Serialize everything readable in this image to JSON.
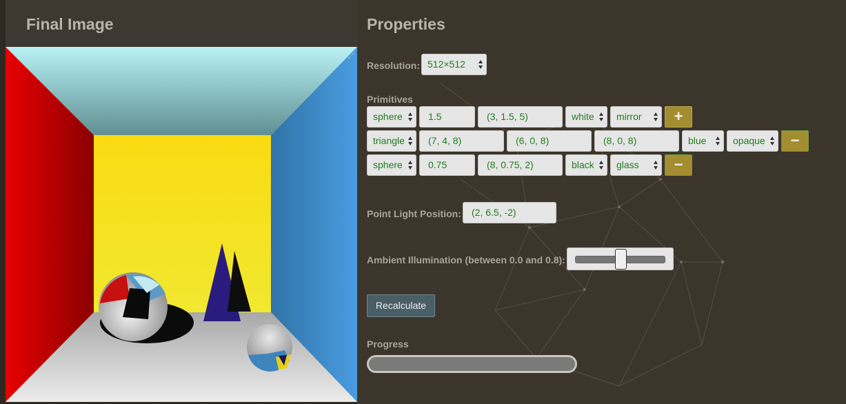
{
  "left": {
    "title": "Final Image"
  },
  "right": {
    "title": "Properties",
    "resolution": {
      "label": "Resolution:",
      "value": "512×512"
    },
    "primitives": {
      "label": "Primitives",
      "rows": [
        {
          "type": "sphere",
          "radius": "1.5",
          "center": "(3, 1.5, 5)",
          "color": "white",
          "material": "mirror",
          "action": "+"
        },
        {
          "type": "triangle",
          "v1": "(7, 4, 8)",
          "v2": "(6, 0, 8)",
          "v3": "(8, 0, 8)",
          "color": "blue",
          "material": "opaque",
          "action": "−"
        },
        {
          "type": "sphere",
          "radius": "0.75",
          "center": "(8, 0.75, 2)",
          "color": "black",
          "material": "glass",
          "action": "−"
        }
      ]
    },
    "light": {
      "label": "Point Light Position:",
      "value": "(2, 6.5, -2)"
    },
    "ambient": {
      "label": "Ambient Illumination (between 0.0 and 0.8):",
      "value": 0.4
    },
    "recalculate_label": "Recalculate",
    "progress": {
      "label": "Progress",
      "value": 0
    }
  },
  "icons": {
    "expand": "expand-icon",
    "plus": "plus-icon",
    "minus": "minus-icon"
  }
}
